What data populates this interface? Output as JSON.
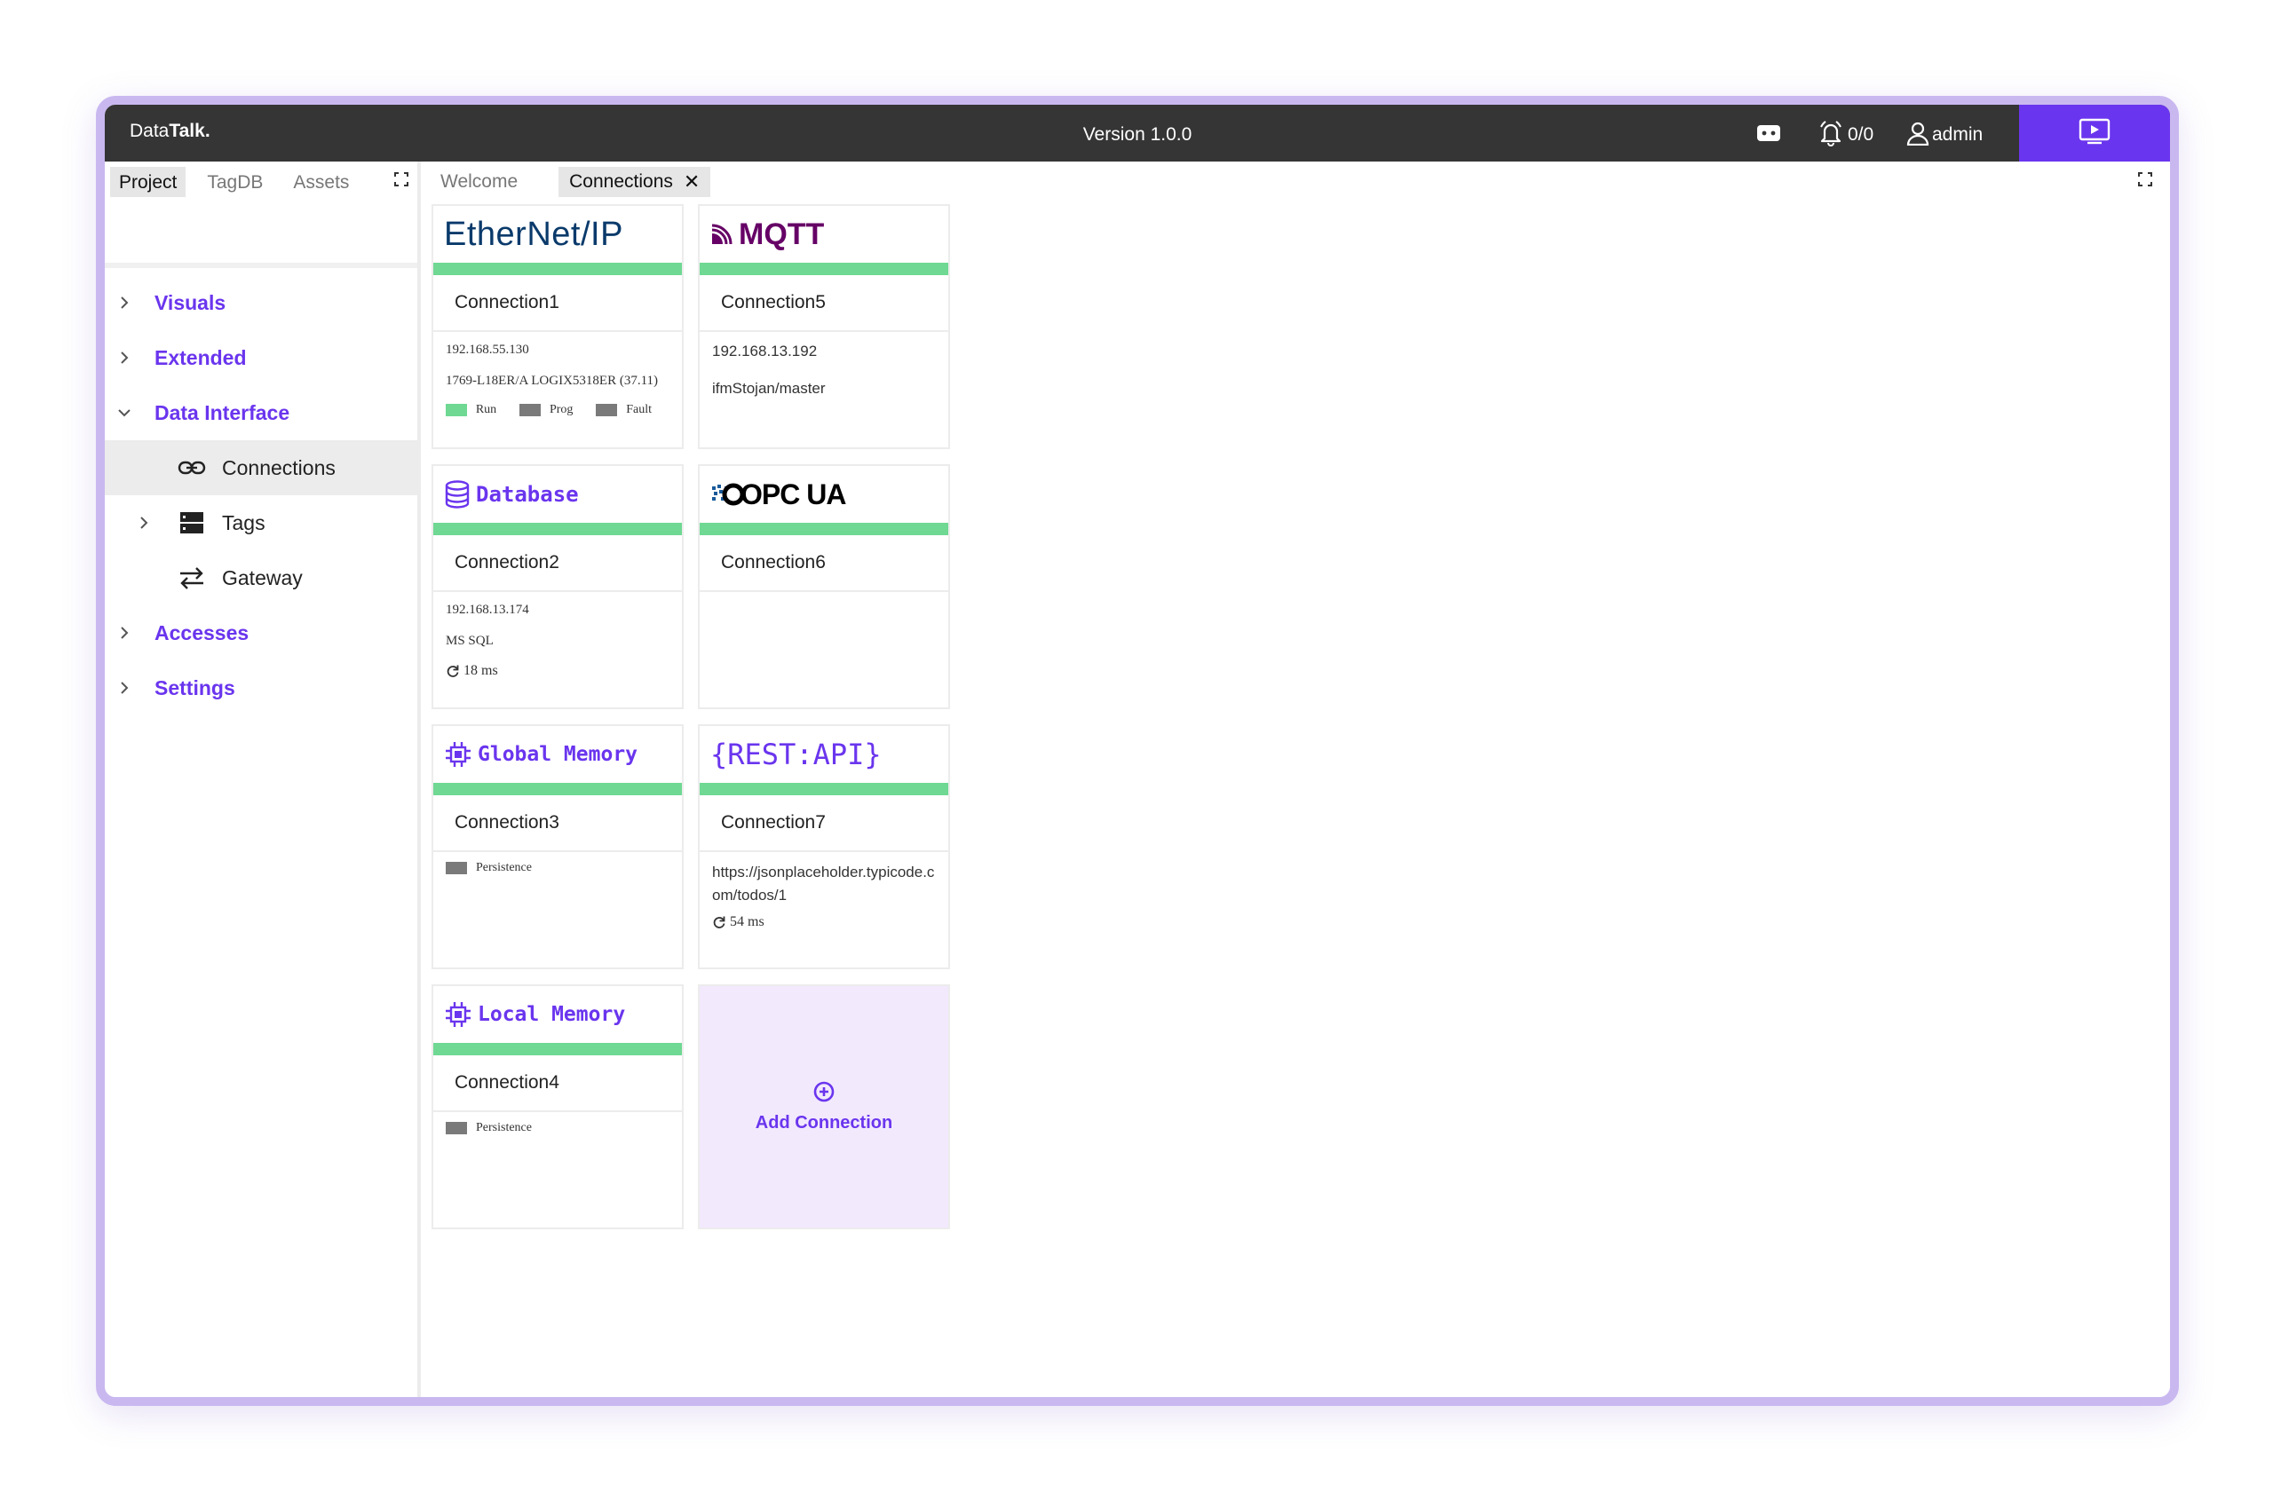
{
  "app": {
    "brand_regular": "Data",
    "brand_bold": "Talk.",
    "version": "Version 1.0.0"
  },
  "topbar": {
    "notification_count": "0/0",
    "user": "admin",
    "icons": [
      "gamepad-icon",
      "bell-icon",
      "user-icon",
      "present-icon"
    ]
  },
  "left_tabs": [
    "Project",
    "TagDB",
    "Assets"
  ],
  "tree": {
    "items": [
      {
        "label": "Visuals"
      },
      {
        "label": "Extended"
      },
      {
        "label": "Data Interface"
      },
      {
        "label": "Accesses"
      },
      {
        "label": "Settings"
      }
    ],
    "sub_items": [
      {
        "label": "Connections",
        "icon": "link-icon"
      },
      {
        "label": "Tags",
        "icon": "server-icon"
      },
      {
        "label": "Gateway",
        "icon": "swap-icon"
      }
    ]
  },
  "main_tabs": [
    "Welcome",
    "Connections"
  ],
  "cards": [
    {
      "logo": "EtherNet/IP",
      "name": "Connection1",
      "ip": "192.168.55.130",
      "model": "1769-L18ER/A LOGIX5318ER (37.11)",
      "status": [
        "Run",
        "Prog",
        "Fault"
      ]
    },
    {
      "logo": "MQTT",
      "name": "Connection5",
      "ip": "192.168.13.192",
      "topic": "ifmStojan/master"
    },
    {
      "logo": "Database",
      "name": "Connection2",
      "ip": "192.168.13.174",
      "db": "MS SQL",
      "latency": "18",
      "latency_unit": "ms"
    },
    {
      "logo": "OPC UA",
      "name": "Connection6"
    },
    {
      "logo": "Global Memory",
      "name": "Connection3",
      "persistence": "Persistence"
    },
    {
      "logo": "{REST:API}",
      "name": "Connection7",
      "url": "https://jsonplaceholder.typicode.com/todos/1",
      "latency": "54",
      "latency_unit": "ms"
    },
    {
      "logo": "Local Memory",
      "name": "Connection4",
      "persistence": "Persistence"
    }
  ],
  "add_connection": "Add Connection",
  "colors": {
    "accent": "#6a35ee",
    "topbar": "#353535",
    "status_green": "#6fd893",
    "status_gray": "#7a7a7a",
    "frame": "#c9b8f0",
    "add_bg": "#f2e9fd"
  }
}
